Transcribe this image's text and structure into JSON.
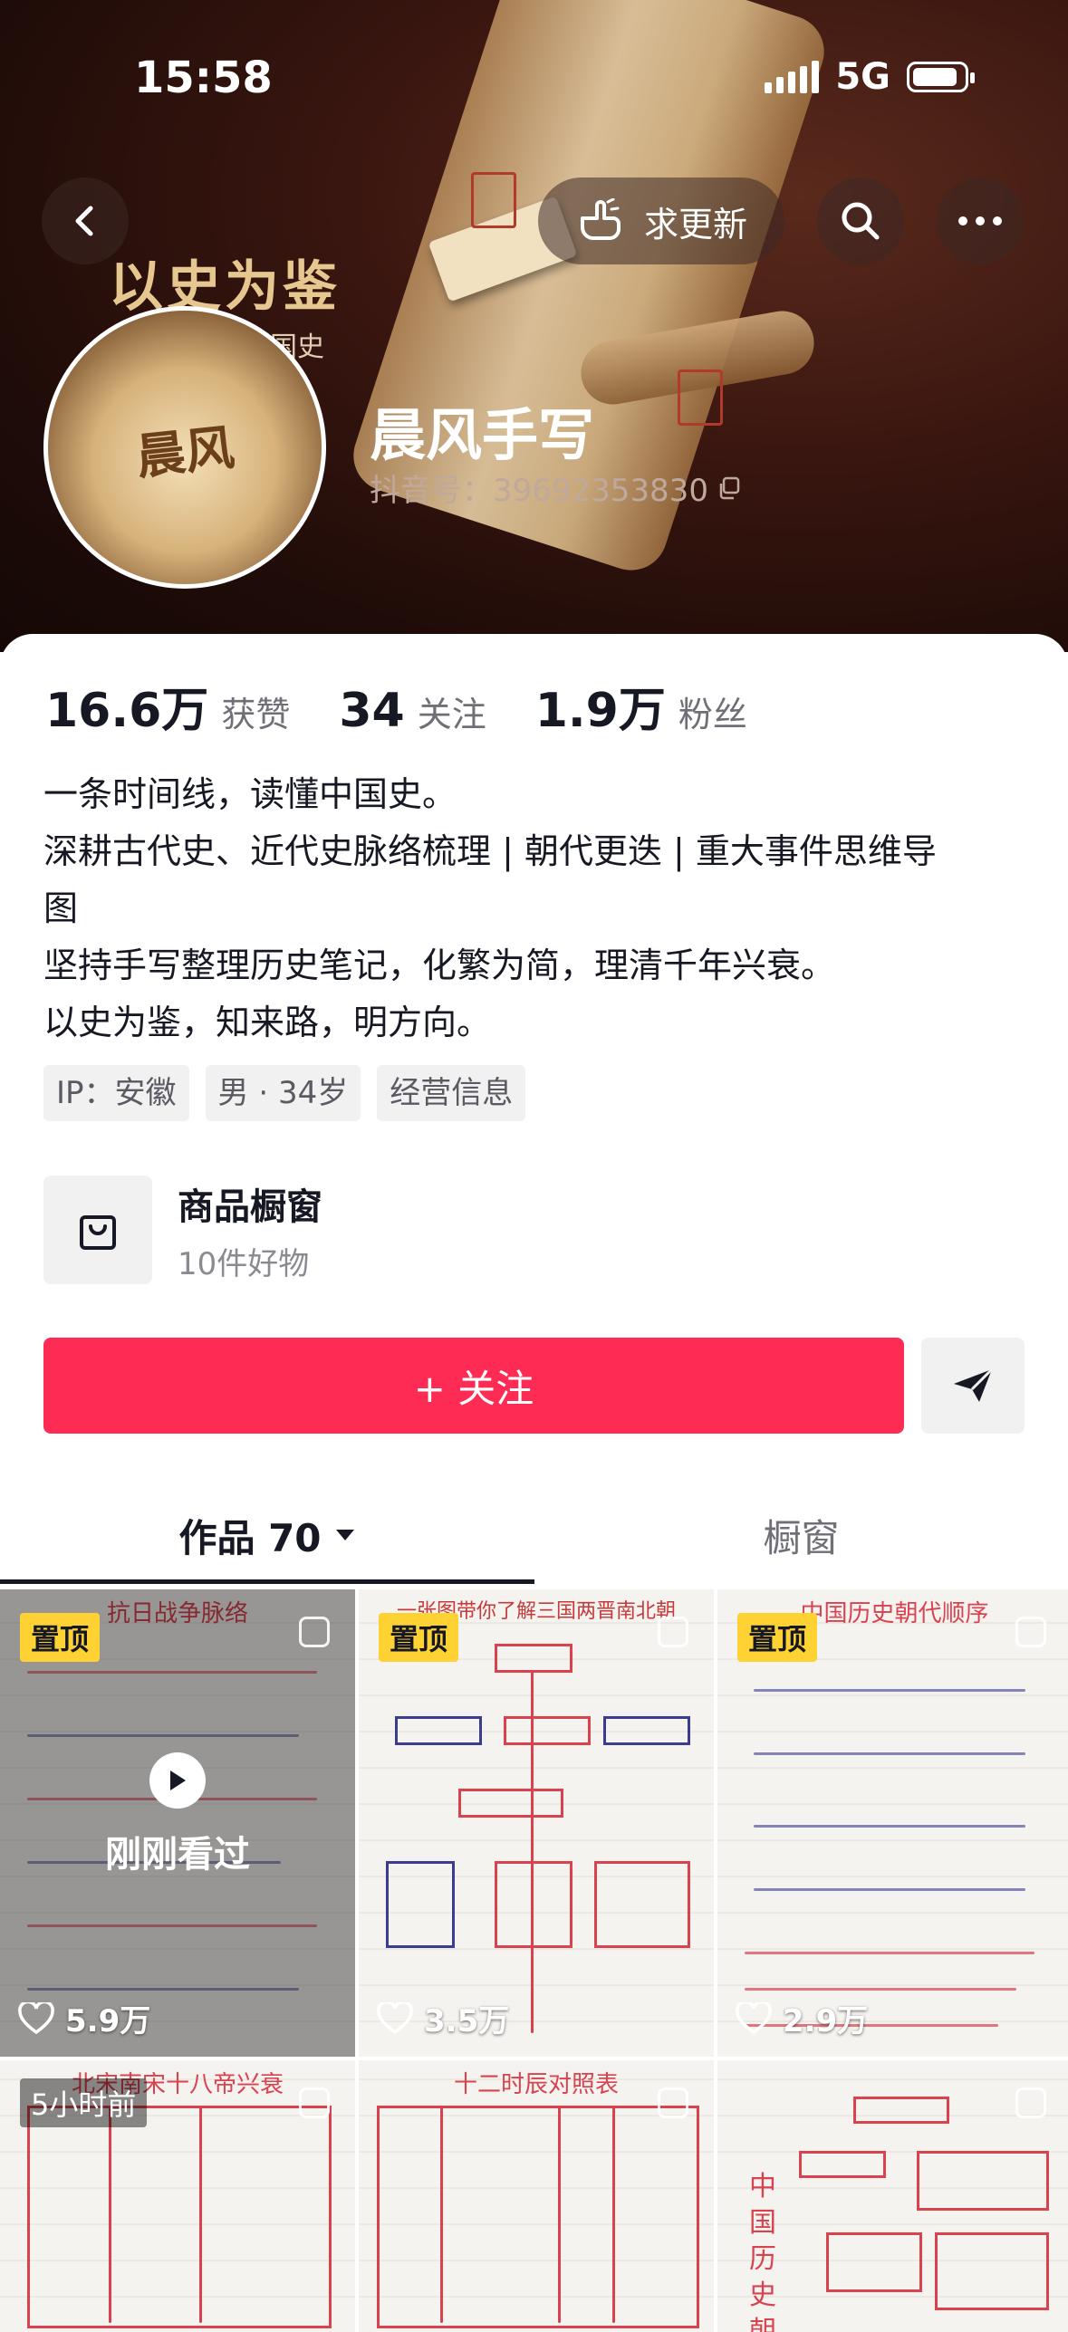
{
  "status_bar": {
    "time": "15:58",
    "network": "5G"
  },
  "header": {
    "back_icon": "chevron-left-icon",
    "update_label": "求更新",
    "search_icon": "search-icon",
    "more_icon": "more-icon",
    "cover_title": "以史为鉴",
    "cover_subtitle": "中国史",
    "avatar_text": "晨风",
    "nickname": "晨风手写",
    "douyin_id": "抖音号：39692353830"
  },
  "stats": [
    {
      "value": "16.6万",
      "label": "获赞"
    },
    {
      "value": "34",
      "label": "关注"
    },
    {
      "value": "1.9万",
      "label": "粉丝"
    }
  ],
  "bio": [
    "一条时间线，读懂中国史。",
    "深耕古代史、近代史脉络梳理 | 朝代更迭 | 重大事件思维导",
    "图",
    "坚持手写整理历史笔记，化繁为简，理清千年兴衰。",
    "以史为鉴，知来路，明方向。"
  ],
  "tags": [
    "IP：安徽",
    "男 · 34岁",
    "经营信息"
  ],
  "shop": {
    "title": "商品橱窗",
    "subtitle": "10件好物"
  },
  "actions": {
    "follow_label": "+ 关注",
    "share_icon": "send-icon"
  },
  "tabs": {
    "works_label": "作品 70",
    "shop_label": "橱窗"
  },
  "grid": [
    {
      "title": "抗日战争脉络",
      "pinned": "置顶",
      "watched": "刚刚看过",
      "likes": "5.9万",
      "accent": "#d9424f"
    },
    {
      "title": "一张图带你了解三国两晋南北朝",
      "pinned": "置顶",
      "likes": "3.5万",
      "accent": "#d9424f"
    },
    {
      "title": "中国历史朝代顺序",
      "pinned": "置顶",
      "likes": "2.9万",
      "accent": "#d9424f"
    },
    {
      "title": "北宋南宋十八帝兴衰",
      "time": "5小时前"
    },
    {
      "title": "十二时辰对照表"
    },
    {
      "title": "中国历史朝代"
    }
  ],
  "colors": {
    "follow": "#fe2c55",
    "pin_badge": "#ffd233"
  }
}
